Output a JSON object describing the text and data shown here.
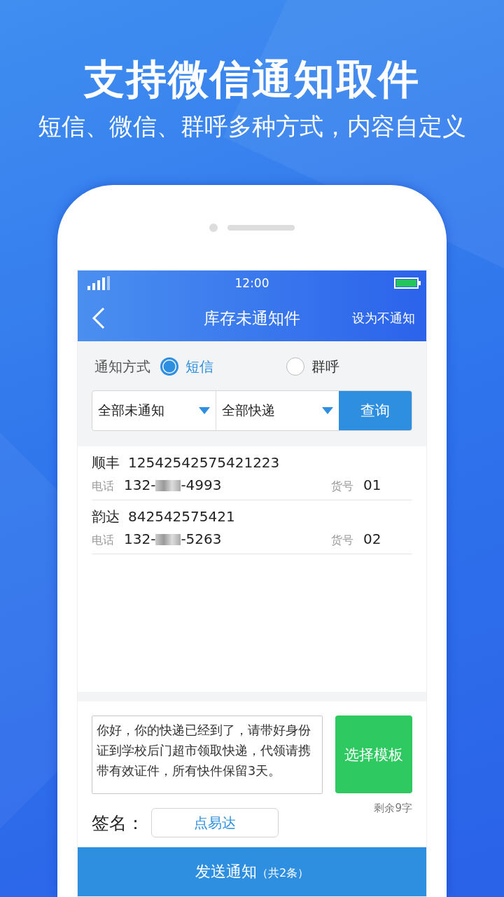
{
  "promo": {
    "headline": "支持微信通知取件",
    "subheadline": "短信、微信、群呼多种方式，内容自定义"
  },
  "status_bar": {
    "time": "12:00"
  },
  "nav": {
    "title": "库存未通知件",
    "action": "设为不通知"
  },
  "notify_method": {
    "label": "通知方式",
    "options": [
      {
        "label": "短信",
        "selected": true
      },
      {
        "label": "群呼",
        "selected": false
      }
    ]
  },
  "filters": [
    {
      "value": "全部未通知"
    },
    {
      "value": "全部快递"
    }
  ],
  "query_button": "查询",
  "parcels": [
    {
      "courier": "顺丰",
      "tracking": "12542542575421223",
      "phone_label": "电话",
      "phone_prefix": "132-",
      "phone_suffix": "-4993",
      "shelf_label": "货号",
      "shelf": "01"
    },
    {
      "courier": "韵达",
      "tracking": "842542575421",
      "phone_label": "电话",
      "phone_prefix": "132-",
      "phone_suffix": "-5263",
      "shelf_label": "货号",
      "shelf": "02"
    }
  ],
  "message": {
    "text": "你好，你的快递已经到了，请带好身份证到学校后门超市领取快递，代领请携带有效证件，所有快件保留3天。",
    "template_button": "选择模板",
    "remaining": "剩余9字"
  },
  "signature": {
    "label": "签名：",
    "value": "点易达"
  },
  "send_button": {
    "label": "发送通知",
    "count": "（共2条）"
  }
}
